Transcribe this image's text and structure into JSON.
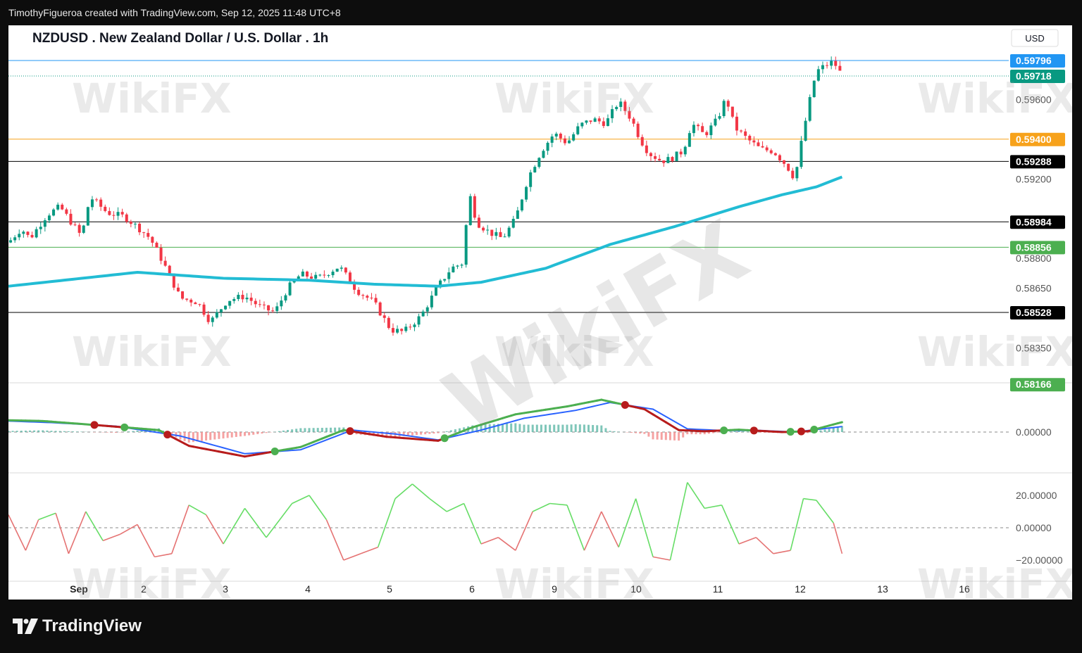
{
  "header": {
    "caption": "TimothyFigueroa created with TradingView.com, Sep 12, 2025 11:48 UTC+8"
  },
  "footer": {
    "brand": "TradingView"
  },
  "watermark_text": "WikiFX",
  "chart_data": {
    "type": "candlestick",
    "title": "NZDUSD . New Zealand Dollar / U.S. Dollar . 1h",
    "currency": "USD",
    "x_labels": [
      "Sep",
      "2",
      "3",
      "4",
      "5",
      "6",
      "9",
      "10",
      "11",
      "12",
      "13",
      "16"
    ],
    "price_ticks": [
      "0.59600",
      "0.59200",
      "0.58800",
      "0.58650",
      "0.58350"
    ],
    "price_lines": [
      {
        "label": "0.59796",
        "value": 0.59796,
        "color": "#2196f3",
        "style": "solid"
      },
      {
        "label": "0.59718",
        "value": 0.59718,
        "color": "#089981",
        "style": "dotted"
      },
      {
        "label": "0.59400",
        "value": 0.594,
        "color": "#f7a21b",
        "style": "solid"
      },
      {
        "label": "0.59288",
        "value": 0.59288,
        "color": "#000000",
        "style": "solid"
      },
      {
        "label": "0.58984",
        "value": 0.58984,
        "color": "#000000",
        "style": "solid"
      },
      {
        "label": "0.58856",
        "value": 0.58856,
        "color": "#4caf50",
        "style": "solid"
      },
      {
        "label": "0.58528",
        "value": 0.58528,
        "color": "#000000",
        "style": "solid"
      },
      {
        "label": "0.58166",
        "value": 0.58166,
        "color": "#4caf50",
        "style": "none"
      }
    ],
    "price_path": [
      [
        0,
        0.5888
      ],
      [
        3,
        0.5895
      ],
      [
        5,
        0.589
      ],
      [
        9,
        0.5902
      ],
      [
        12,
        0.5906
      ],
      [
        17,
        0.5891
      ],
      [
        19,
        0.5911
      ],
      [
        23,
        0.5903
      ],
      [
        27,
        0.5901
      ],
      [
        31,
        0.5894
      ],
      [
        33,
        0.589
      ],
      [
        36,
        0.5878
      ],
      [
        40,
        0.586
      ],
      [
        44,
        0.5858
      ],
      [
        47,
        0.5848
      ],
      [
        51,
        0.5859
      ],
      [
        55,
        0.5861
      ],
      [
        59,
        0.5855
      ],
      [
        62,
        0.5853
      ],
      [
        65,
        0.5865
      ],
      [
        68,
        0.5872
      ],
      [
        72,
        0.587
      ],
      [
        77,
        0.5876
      ],
      [
        81,
        0.5864
      ],
      [
        85,
        0.5858
      ],
      [
        89,
        0.5844
      ],
      [
        92,
        0.5843
      ],
      [
        96,
        0.5851
      ],
      [
        100,
        0.5866
      ],
      [
        103,
        0.5875
      ],
      [
        106,
        0.5878
      ],
      [
        107,
        0.5915
      ],
      [
        109,
        0.5898
      ],
      [
        112,
        0.5893
      ],
      [
        115,
        0.589
      ],
      [
        118,
        0.59
      ],
      [
        121,
        0.5921
      ],
      [
        124,
        0.5934
      ],
      [
        127,
        0.5943
      ],
      [
        130,
        0.5938
      ],
      [
        133,
        0.5947
      ],
      [
        136,
        0.595
      ],
      [
        139,
        0.5948
      ],
      [
        142,
        0.5959
      ],
      [
        145,
        0.595
      ],
      [
        147,
        0.594
      ],
      [
        149,
        0.5933
      ],
      [
        152,
        0.5929
      ],
      [
        154,
        0.593
      ],
      [
        157,
        0.5934
      ],
      [
        159,
        0.5948
      ],
      [
        162,
        0.5942
      ],
      [
        165,
        0.595
      ],
      [
        167,
        0.5961
      ],
      [
        169,
        0.5946
      ],
      [
        172,
        0.594
      ],
      [
        175,
        0.5935
      ],
      [
        178,
        0.5934
      ],
      [
        181,
        0.5927
      ],
      [
        183,
        0.592
      ],
      [
        185,
        0.5944
      ],
      [
        187,
        0.5965
      ],
      [
        188,
        0.5974
      ],
      [
        190,
        0.5977
      ],
      [
        192,
        0.5979
      ],
      [
        194,
        0.5972
      ]
    ],
    "ma_path": [
      [
        0,
        0.5866
      ],
      [
        30,
        0.5873
      ],
      [
        50,
        0.587
      ],
      [
        70,
        0.5869
      ],
      [
        85,
        0.5867
      ],
      [
        100,
        0.5866
      ],
      [
        110,
        0.5868
      ],
      [
        125,
        0.5875
      ],
      [
        140,
        0.5887
      ],
      [
        155,
        0.5896
      ],
      [
        170,
        0.5906
      ],
      [
        180,
        0.5912
      ],
      [
        188,
        0.5916
      ],
      [
        194,
        0.5921
      ]
    ],
    "macd": {
      "zero_label": "0.00000",
      "macd_line": [
        [
          0,
          0.3
        ],
        [
          8,
          0.28
        ],
        [
          20,
          0.18
        ],
        [
          35,
          0.05
        ],
        [
          42,
          -0.35
        ],
        [
          55,
          -0.62
        ],
        [
          68,
          -0.38
        ],
        [
          78,
          0.05
        ],
        [
          88,
          -0.12
        ],
        [
          100,
          -0.22
        ],
        [
          108,
          0.12
        ],
        [
          118,
          0.45
        ],
        [
          130,
          0.65
        ],
        [
          138,
          0.82
        ],
        [
          148,
          0.58
        ],
        [
          156,
          0.05
        ],
        [
          162,
          0.02
        ],
        [
          170,
          0.06
        ],
        [
          180,
          0.0
        ],
        [
          186,
          0.02
        ],
        [
          194,
          0.25
        ]
      ],
      "signal_line": [
        [
          0,
          0.28
        ],
        [
          10,
          0.24
        ],
        [
          25,
          0.15
        ],
        [
          40,
          -0.1
        ],
        [
          55,
          -0.55
        ],
        [
          68,
          -0.45
        ],
        [
          80,
          0.05
        ],
        [
          90,
          -0.05
        ],
        [
          100,
          -0.2
        ],
        [
          110,
          0.05
        ],
        [
          120,
          0.35
        ],
        [
          132,
          0.55
        ],
        [
          140,
          0.75
        ],
        [
          150,
          0.58
        ],
        [
          158,
          0.08
        ],
        [
          166,
          0.04
        ],
        [
          175,
          0.04
        ],
        [
          183,
          0.0
        ],
        [
          194,
          0.14
        ]
      ]
    },
    "oscillator": {
      "ticks": [
        "20.00000",
        "0.00000",
        "−20.00000"
      ],
      "path": [
        [
          0,
          8
        ],
        [
          4,
          -14
        ],
        [
          7,
          5
        ],
        [
          11,
          9
        ],
        [
          14,
          -16
        ],
        [
          18,
          10
        ],
        [
          22,
          -8
        ],
        [
          26,
          -4
        ],
        [
          30,
          2
        ],
        [
          34,
          -18
        ],
        [
          38,
          -16
        ],
        [
          42,
          14
        ],
        [
          46,
          8
        ],
        [
          50,
          -10
        ],
        [
          55,
          12
        ],
        [
          60,
          -6
        ],
        [
          66,
          15
        ],
        [
          70,
          20
        ],
        [
          74,
          5
        ],
        [
          78,
          -20
        ],
        [
          82,
          -16
        ],
        [
          86,
          -12
        ],
        [
          90,
          18
        ],
        [
          94,
          27
        ],
        [
          98,
          18
        ],
        [
          102,
          10
        ],
        [
          106,
          15
        ],
        [
          110,
          -10
        ],
        [
          114,
          -6
        ],
        [
          118,
          -14
        ],
        [
          122,
          10
        ],
        [
          126,
          15
        ],
        [
          130,
          14
        ],
        [
          134,
          -14
        ],
        [
          138,
          10
        ],
        [
          142,
          -12
        ],
        [
          146,
          18
        ],
        [
          150,
          -18
        ],
        [
          154,
          -20
        ],
        [
          158,
          28
        ],
        [
          162,
          12
        ],
        [
          166,
          14
        ],
        [
          170,
          -10
        ],
        [
          174,
          -6
        ],
        [
          178,
          -16
        ],
        [
          182,
          -14
        ],
        [
          185,
          18
        ],
        [
          188,
          17
        ],
        [
          192,
          3
        ],
        [
          194,
          -16
        ]
      ]
    }
  }
}
